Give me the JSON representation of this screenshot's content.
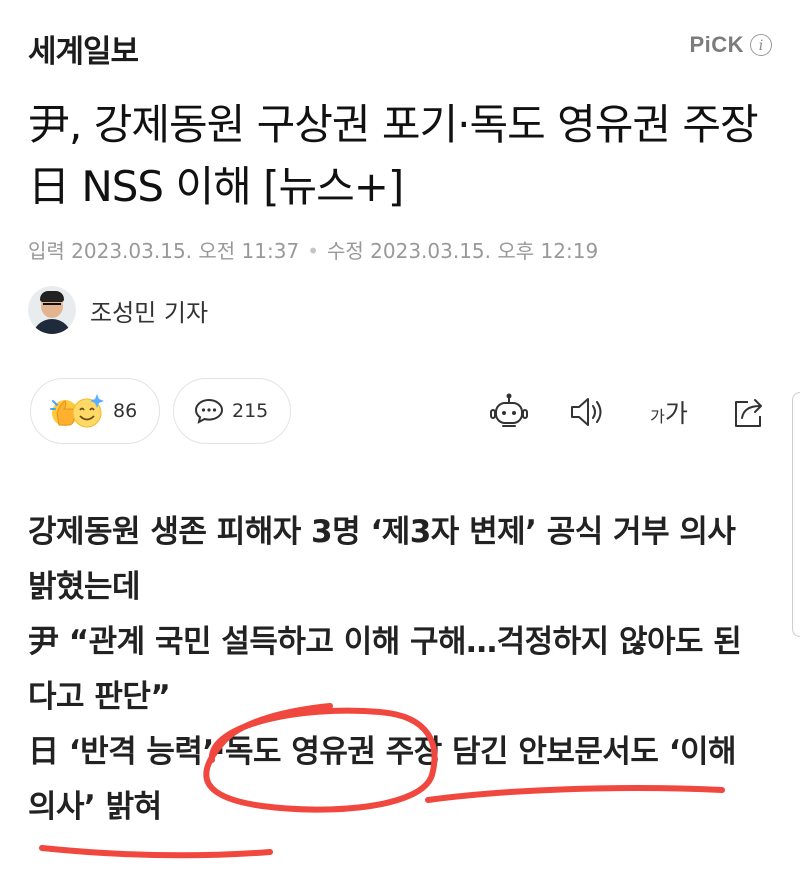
{
  "header": {
    "logo": "세계일보",
    "pick_label": "PiCK",
    "info_icon": "info-icon",
    "info_glyph": "i"
  },
  "article": {
    "headline": "尹, 강제동원 구상권 포기·독도 영유권 주장 日 NSS 이해 [뉴스+]",
    "input_date": "입력 2023.03.15. 오전 11:37",
    "modified_date": "수정 2023.03.15. 오후 12:19",
    "date_separator": "•",
    "author": "조성민 기자"
  },
  "actions": {
    "reaction_count": "86",
    "comment_count": "215",
    "font_size_small": "가",
    "font_size_large": "가",
    "icons": [
      "reaction-emoji-icon",
      "comment-bubble-icon",
      "robot-summary-icon",
      "speaker-icon",
      "font-size-icon",
      "share-icon"
    ]
  },
  "summary": {
    "line1": "강제동원 생존 피해자 3명 ‘제3자 변제’ 공식 거부 의사 밝혔는데",
    "line2": "尹 “관계 국민 설득하고 이해 구해…걱정하지 않아도 된다고 판단”",
    "line3": "日 ‘반격 능력’·독도 영유권 주장 담긴 안보문서도 ‘이해 의사’ 밝혀"
  },
  "colors": {
    "annotation_red": "#f0473e",
    "pick_gray": "#7c7c7c",
    "date_gray": "#999999"
  }
}
